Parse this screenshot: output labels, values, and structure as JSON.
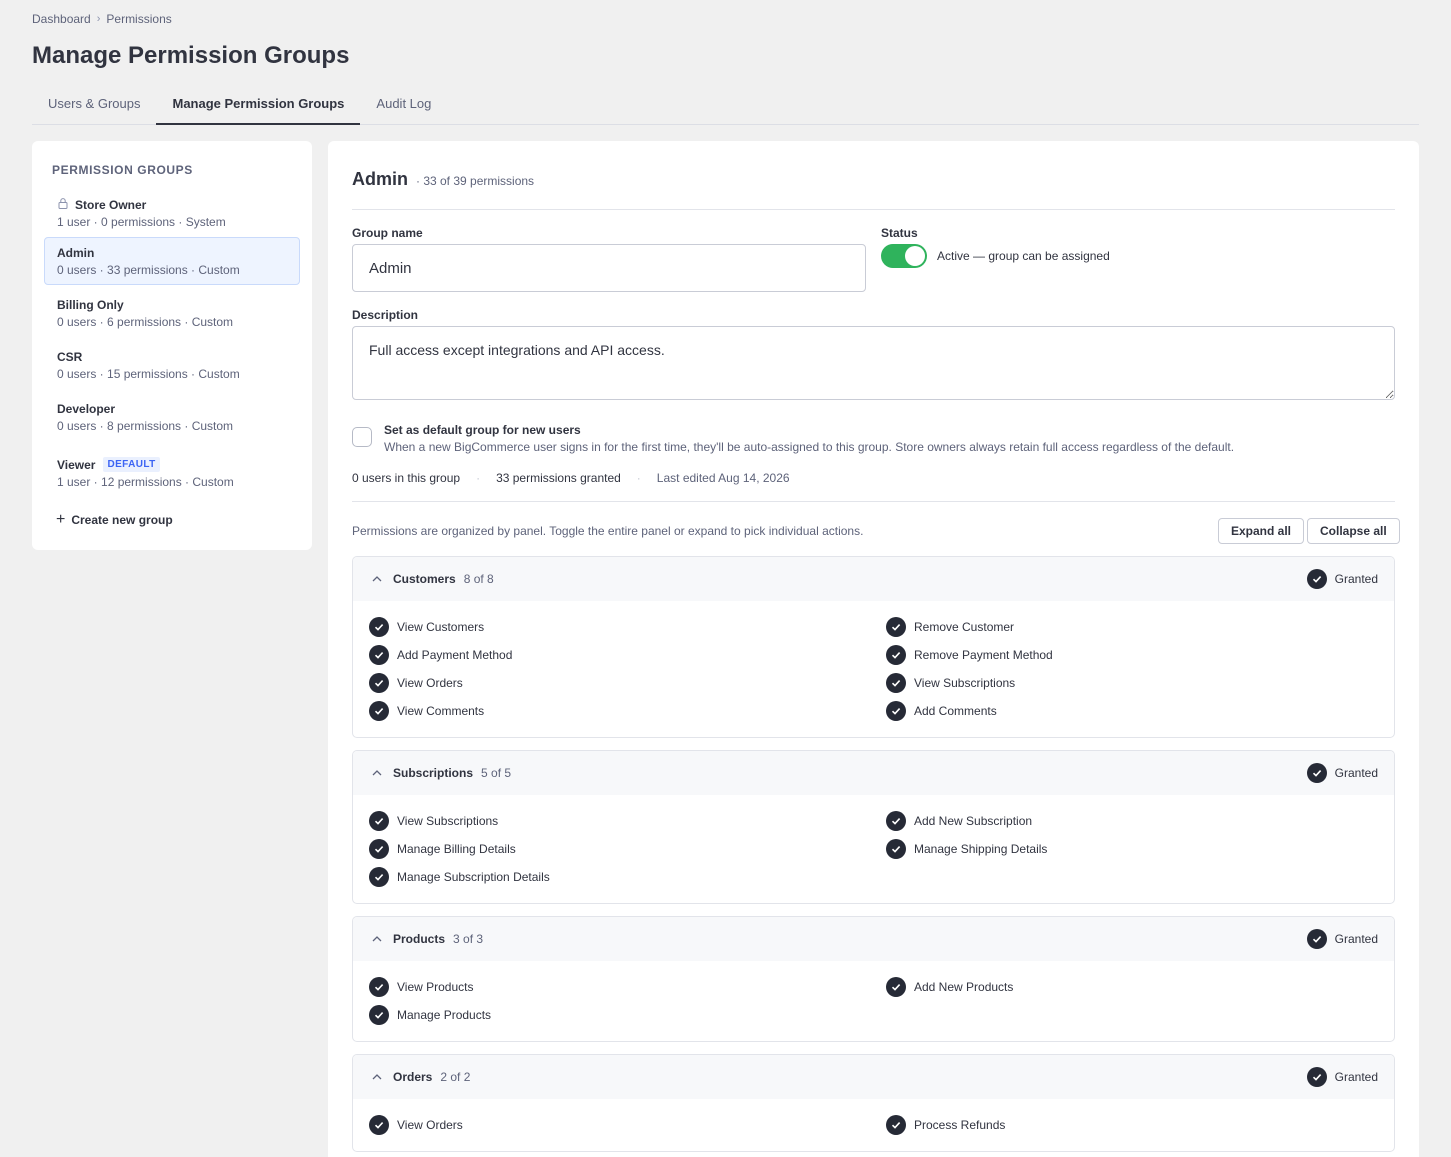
{
  "breadcrumb": {
    "items": [
      "Dashboard",
      "Permissions"
    ],
    "separator": "›"
  },
  "page": {
    "title": "Manage Permission Groups"
  },
  "tabs": [
    {
      "label": "Users & Groups",
      "active": false
    },
    {
      "label": "Manage Permission Groups",
      "active": true
    },
    {
      "label": "Audit Log",
      "active": false
    }
  ],
  "sidebar": {
    "title": "PERMISSION GROUPS",
    "groups": [
      {
        "name": "Store Owner",
        "meta": "1 user · 0 permissions · System",
        "locked": true,
        "badge": ""
      },
      {
        "name": "Admin",
        "meta": "0 users · 33 permissions · Custom",
        "selected": true,
        "badge": ""
      },
      {
        "name": "Billing Only",
        "meta": "0 users · 6 permissions · Custom",
        "badge": ""
      },
      {
        "name": "CSR",
        "meta": "0 users · 15 permissions · Custom",
        "badge": ""
      },
      {
        "name": "Developer",
        "meta": "0 users · 8 permissions · Custom",
        "badge": ""
      },
      {
        "name": "Viewer",
        "meta": "1 user · 12 permissions · Custom",
        "badge": "DEFAULT"
      }
    ],
    "create_label": "Create new group"
  },
  "detail": {
    "title": "Admin",
    "count": "· 33 of 39 permissions",
    "group_name_label": "Group name",
    "group_name_value": "Admin",
    "status_label": "Status",
    "status_text": "Active — group can be assigned",
    "description_label": "Description",
    "description_value": "Full access except integrations and API access.",
    "default_title": "Set as default group for new users",
    "default_desc": "When a new BigCommerce user signs in for the first time, they'll be auto-assigned to this group. Store owners always retain full access regardless of the default.",
    "stats": {
      "users": "0 users in this group",
      "permissions": "33 permissions granted",
      "edited": "Last edited Aug 14, 2026"
    },
    "perm_note": "Permissions are organized by panel. Toggle the entire panel or expand to pick individual actions.",
    "expand_all": "Expand all",
    "collapse_all": "Collapse all"
  },
  "panels": [
    {
      "name": "Customers",
      "count": "8 of 8",
      "status": "Granted",
      "permissions": [
        "View Customers",
        "Remove Customer",
        "Add Payment Method",
        "Remove Payment Method",
        "View Orders",
        "View Subscriptions",
        "View Comments",
        "Add Comments"
      ]
    },
    {
      "name": "Subscriptions",
      "count": "5 of 5",
      "status": "Granted",
      "permissions": [
        "View Subscriptions",
        "Add New Subscription",
        "Manage Billing Details",
        "Manage Shipping Details",
        "Manage Subscription Details"
      ]
    },
    {
      "name": "Products",
      "count": "3 of 3",
      "status": "Granted",
      "permissions": [
        "View Products",
        "Add New Products",
        "Manage Products"
      ]
    },
    {
      "name": "Orders",
      "count": "2 of 2",
      "status": "Granted",
      "permissions": [
        "View Orders",
        "Process Refunds"
      ]
    }
  ],
  "colors": {
    "accent": "#3c64f4",
    "toggle_on": "#2fb35c",
    "check": "#262a36",
    "text": "#313440",
    "muted": "#5e637a"
  }
}
